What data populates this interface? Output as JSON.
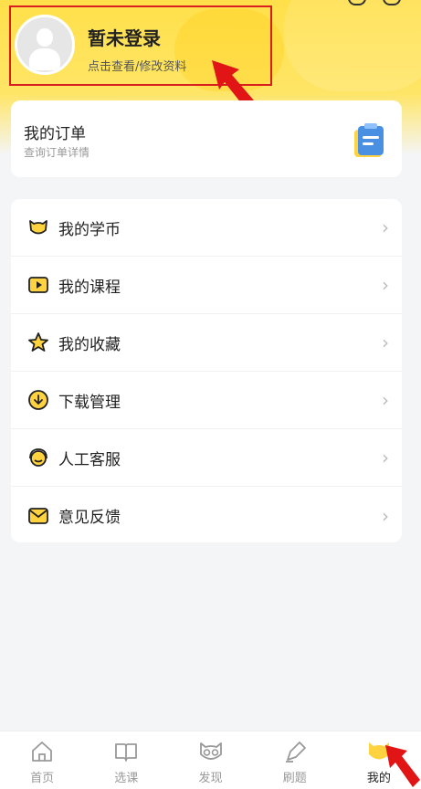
{
  "profile": {
    "name": "暂未登录",
    "subtitle": "点击查看/修改资料"
  },
  "order": {
    "title": "我的订单",
    "subtitle": "查询订单详情",
    "icon": "clipboard-icon"
  },
  "menu": [
    {
      "label": "我的学币",
      "icon": "coin-cat-icon"
    },
    {
      "label": "我的课程",
      "icon": "play-course-icon"
    },
    {
      "label": "我的收藏",
      "icon": "star-icon"
    },
    {
      "label": "下载管理",
      "icon": "download-icon"
    },
    {
      "label": "人工客服",
      "icon": "headset-icon"
    },
    {
      "label": "意见反馈",
      "icon": "mail-icon"
    }
  ],
  "tabs": [
    {
      "label": "首页",
      "icon": "home-icon"
    },
    {
      "label": "选课",
      "icon": "book-icon"
    },
    {
      "label": "发现",
      "icon": "cat-glasses-icon"
    },
    {
      "label": "刷题",
      "icon": "pen-icon"
    },
    {
      "label": "我的",
      "icon": "profile-cat-icon"
    }
  ],
  "active_tab": "我的",
  "colors": {
    "accent": "#ffe04a",
    "highlight_box": "#d81e1e",
    "arrow": "#e11515"
  }
}
